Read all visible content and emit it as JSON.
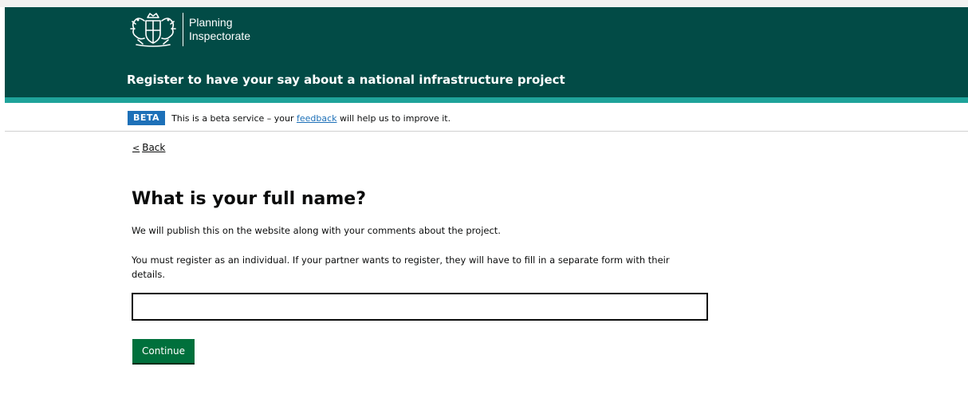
{
  "header": {
    "logo_line1": "Planning",
    "logo_line2": "Inspectorate",
    "service_name": "Register to have your say about a national infrastructure project",
    "crest_icon": "royal-coat-of-arms-icon",
    "background_color": "#024b46",
    "accent_color": "#1ea39a"
  },
  "beta_banner": {
    "tag": "BETA",
    "text_before": "This is a beta service – your ",
    "link_text": "feedback",
    "text_after": " will help us to improve it.",
    "tag_color": "#1d70b8"
  },
  "back_link": {
    "label": "Back",
    "icon": "chevron-left-icon"
  },
  "main": {
    "title": "What is your full name?",
    "paragraph_1": "We will publish this on the website along with your comments about the project.",
    "paragraph_2": "You must register as an individual. If your partner wants to register, they will have to fill in a separate form with their details.",
    "name_input_value": "",
    "continue_label": "Continue",
    "button_color": "#00703c"
  }
}
